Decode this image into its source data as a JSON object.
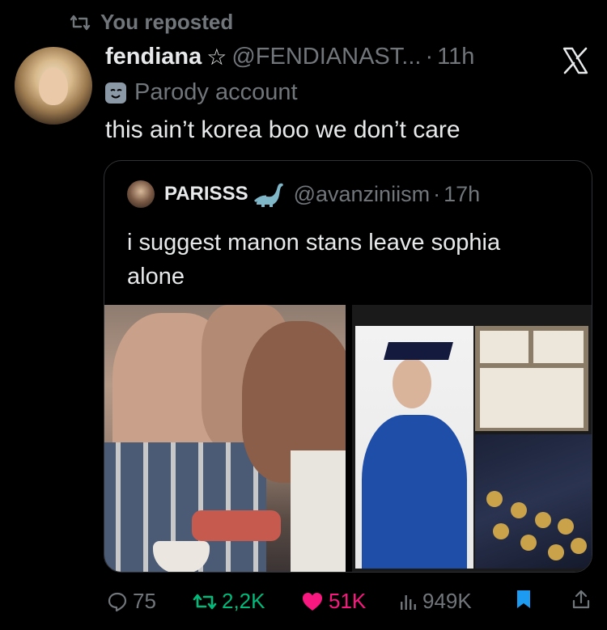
{
  "repost_banner": {
    "text": "You reposted"
  },
  "author": {
    "name": "fendiana",
    "star": "☆",
    "handle": "@FENDIANAST...",
    "dot": "·",
    "time": "11h",
    "label": "Parody account"
  },
  "tweet": {
    "text": "this ain’t korea boo we don’t care"
  },
  "quoted": {
    "name": "PARISSS",
    "handle": "@avanziniism",
    "dot": "·",
    "time": "17h",
    "text": "i suggest manon stans leave sophia alone"
  },
  "actions": {
    "replies": "75",
    "reposts": "2,2K",
    "likes": "51K",
    "views": "949K"
  },
  "colors": {
    "background": "#000000",
    "text": "#e7e9ea",
    "muted": "#71767b",
    "repost_active": "#00ba7c",
    "like_active": "#f91880",
    "bookmark_active": "#1d9bf0"
  }
}
